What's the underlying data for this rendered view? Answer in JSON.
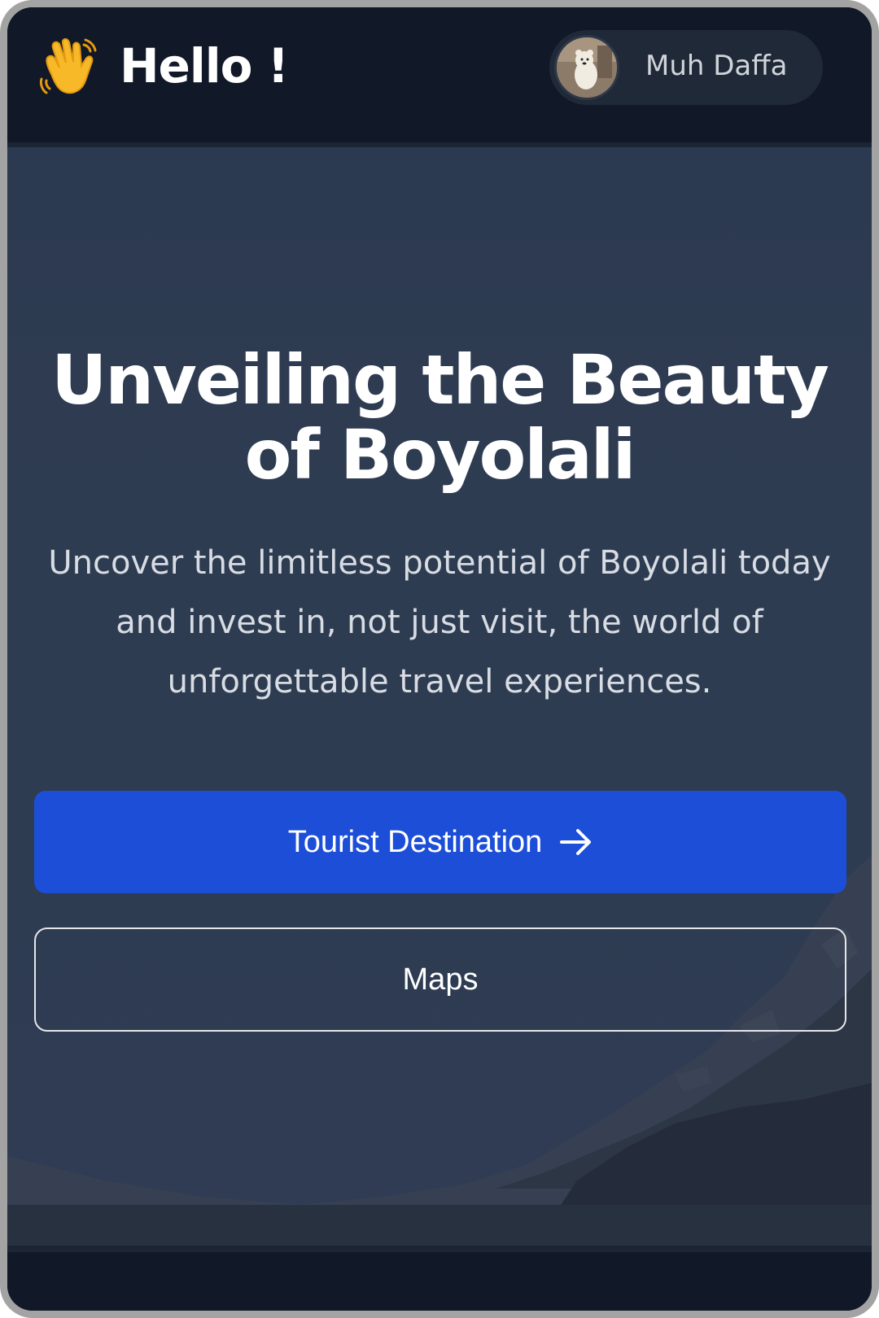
{
  "header": {
    "greeting": "Hello !",
    "greeting_icon": "waving-hand-icon",
    "user": {
      "name": "Muh Daffa",
      "avatar_icon": "bear-avatar"
    }
  },
  "hero": {
    "title": "Unveiling the Beauty of Boyolali",
    "subtitle": "Uncover the limitless potential of Boyolali today and invest in, not just visit, the world of unforgettable travel experiences.",
    "primary_button": {
      "label": "Tourist Destination",
      "icon": "arrow-right-icon"
    },
    "secondary_button": {
      "label": "Maps"
    }
  },
  "colors": {
    "background": "#111827",
    "hero_overlay": "#2f3c52",
    "primary": "#1d4ed8",
    "text": "#ffffff"
  }
}
